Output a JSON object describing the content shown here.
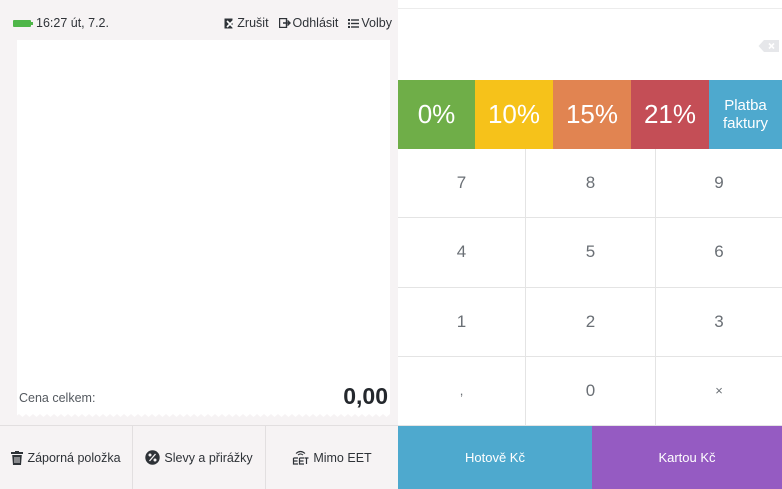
{
  "status": {
    "time": "16:27 út, 7.2.",
    "actions": [
      {
        "label": "Zrušit",
        "icon": "cancel-receipt-icon"
      },
      {
        "label": "Odhlásit",
        "icon": "logout-icon"
      },
      {
        "label": "Volby",
        "icon": "menu-list-icon"
      }
    ]
  },
  "receipt": {
    "total_label": "Cena celkem:",
    "total_value": "0,00"
  },
  "bottom_actions": [
    {
      "label": "Záporná položka",
      "icon": "trash-icon"
    },
    {
      "label": "Slevy a přirážky",
      "icon": "percent-badge-icon"
    },
    {
      "label": "Mimo EET",
      "icon": "eet-icon"
    }
  ],
  "vat_buttons": {
    "v0": "0%",
    "v10": "10%",
    "v15": "15%",
    "v21": "21%",
    "invoice_line1": "Platba",
    "invoice_line2": "faktury"
  },
  "keypad": [
    "7",
    "8",
    "9",
    "4",
    "5",
    "6",
    "1",
    "2",
    "3",
    ",",
    "0",
    "×"
  ],
  "payment": {
    "cash": "Hotově Kč",
    "card": "Kartou Kč"
  },
  "colors": {
    "vat0": "#6fae48",
    "vat10": "#f6c21a",
    "vat15": "#e18451",
    "vat21": "#c44e56",
    "invoice": "#4ea9ce",
    "cash": "#4ea9ce",
    "card": "#955bc2",
    "battery": "#4fb649"
  }
}
